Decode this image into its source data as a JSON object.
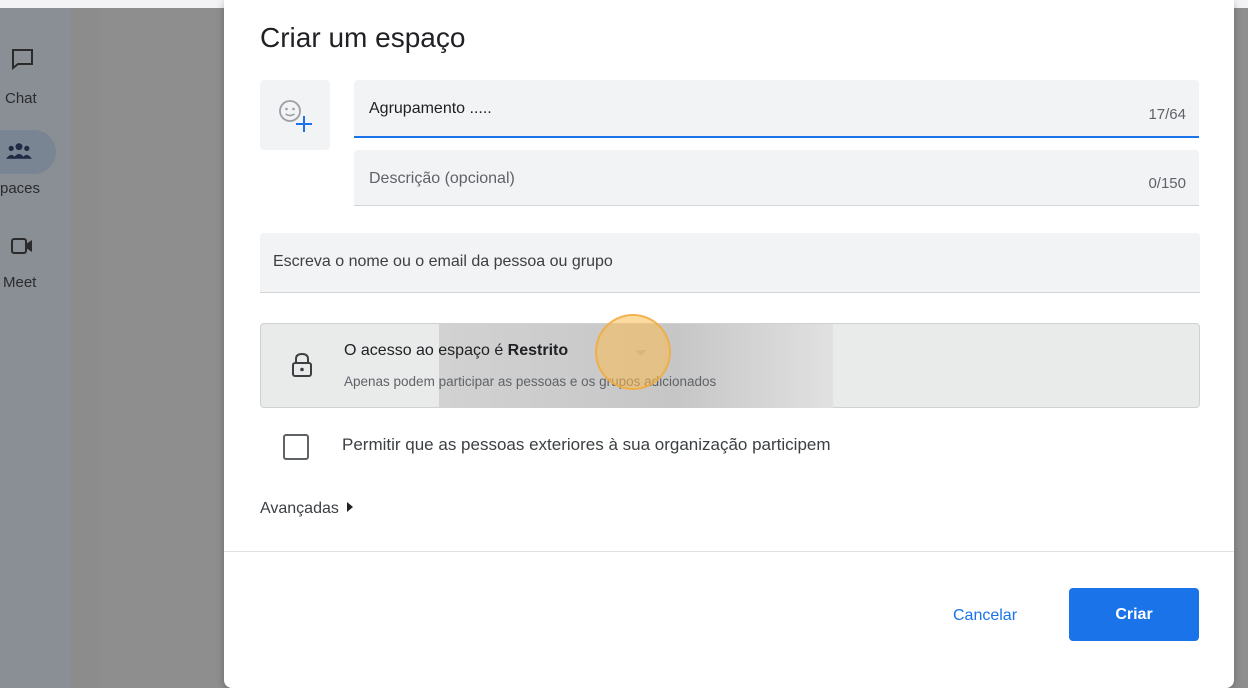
{
  "rail": {
    "items": [
      {
        "label": "Chat",
        "icon": "chat-icon"
      },
      {
        "label": "paces",
        "icon": "spaces-icon"
      },
      {
        "label": "Meet",
        "icon": "meet-icon"
      }
    ]
  },
  "dialog": {
    "title": "Criar um espaço",
    "name_field": {
      "value": "Agrupamento .....",
      "counter": "17/64"
    },
    "description_field": {
      "placeholder": "Descrição (opcional)",
      "counter": "0/150"
    },
    "people_field": {
      "placeholder": "Escreva o nome ou o email da pessoa ou grupo"
    },
    "access": {
      "prefix": "O acesso ao espaço é ",
      "value": "Restrito",
      "subtitle": "Apenas podem participar as pessoas e os grupos adicionados"
    },
    "external_checkbox": {
      "label": "Permitir que as pessoas exteriores à sua organização participem",
      "checked": false
    },
    "advanced_label": "Avançadas",
    "buttons": {
      "cancel": "Cancelar",
      "create": "Criar"
    }
  },
  "colors": {
    "accent": "#1a73e8",
    "click_marker": "#fbbc50"
  }
}
